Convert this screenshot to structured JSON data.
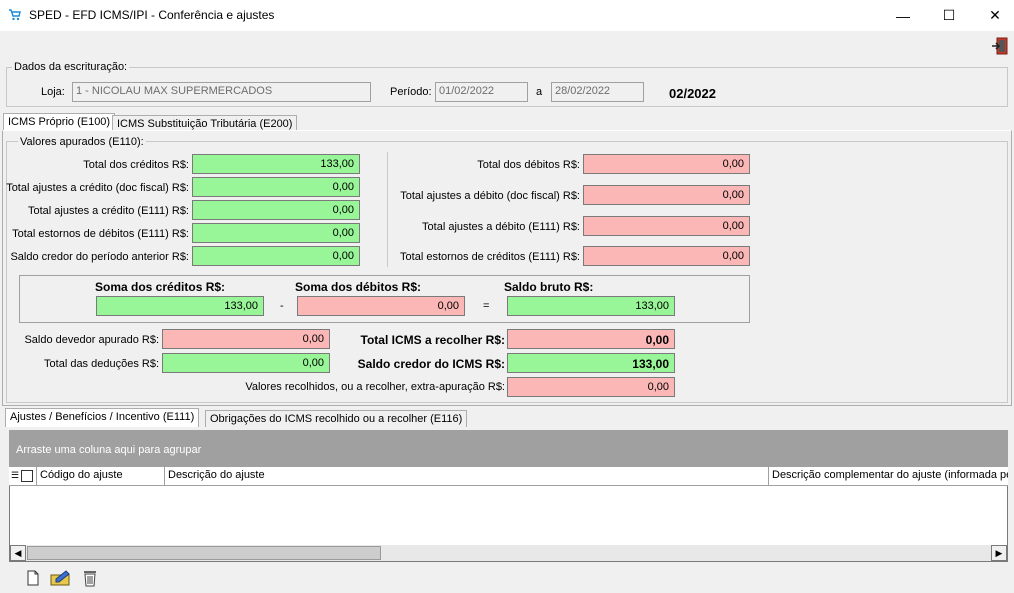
{
  "window": {
    "title": "SPED - EFD ICMS/IPI - Conferência e ajustes",
    "minimize": "—",
    "maximize": "☐",
    "close": "✕"
  },
  "escrituracao": {
    "group_title": "Dados da escrituração:",
    "loja_label": "Loja:",
    "loja_value": "1 - NICOLAU MAX SUPERMERCADOS",
    "periodo_label": "Período:",
    "periodo_inicio": "01/02/2022",
    "a_label": "a",
    "periodo_fim": "28/02/2022",
    "competencia": "02/2022"
  },
  "tabs": {
    "icms_proprio": "ICMS Próprio (E100)",
    "icms_st": "ICMS Substituição Tributária (E200)"
  },
  "apuracao": {
    "group_title": "Valores apurados (E110):",
    "creditos": [
      {
        "label": "Total dos créditos R$:",
        "value": "133,00"
      },
      {
        "label": "Total ajustes a crédito (doc fiscal) R$:",
        "value": "0,00"
      },
      {
        "label": "Total ajustes a crédito (E111) R$:",
        "value": "0,00"
      },
      {
        "label": "Total estornos de débitos (E111) R$:",
        "value": "0,00"
      },
      {
        "label": "Saldo credor do período anterior R$:",
        "value": "0,00"
      }
    ],
    "debitos": [
      {
        "label": "Total dos débitos R$:",
        "value": "0,00"
      },
      {
        "label": "Total ajustes a débito (doc fiscal) R$:",
        "value": "0,00"
      },
      {
        "label": "Total ajustes a débito (E111) R$:",
        "value": "0,00"
      },
      {
        "label": "Total estornos de créditos (E111) R$:",
        "value": "0,00"
      }
    ],
    "soma_creditos_label": "Soma dos créditos R$:",
    "soma_creditos": "133,00",
    "minus": "-",
    "soma_debitos_label": "Soma dos débitos R$:",
    "soma_debitos": "0,00",
    "equals": "=",
    "saldo_bruto_label": "Saldo bruto R$:",
    "saldo_bruto": "133,00",
    "saldo_devedor_label": "Saldo devedor apurado R$:",
    "saldo_devedor": "0,00",
    "deducoes_label": "Total das deduções R$:",
    "deducoes": "0,00",
    "icms_recolher_label": "Total ICMS a recolher R$:",
    "icms_recolher": "0,00",
    "saldo_credor_label": "Saldo credor do ICMS R$:",
    "saldo_credor": "133,00",
    "extra_label": "Valores recolhidos, ou a recolher, extra-apuração R$:",
    "extra": "0,00"
  },
  "subtabs": {
    "ajustes": "Ajustes / Benefícios / Incentivo (E111)",
    "obrigacoes": "Obrigações do ICMS recolhido ou a recolher (E116)"
  },
  "grid": {
    "group_hint": "Arraste uma coluna aqui para agrupar",
    "columns": [
      "Código do ajuste",
      "Descrição do ajuste",
      "Descrição complementar do ajuste (informada pelo"
    ]
  },
  "colors": {
    "green": "#98f598",
    "pink": "#fbb6b6",
    "grid_header": "#a0a0a0"
  }
}
